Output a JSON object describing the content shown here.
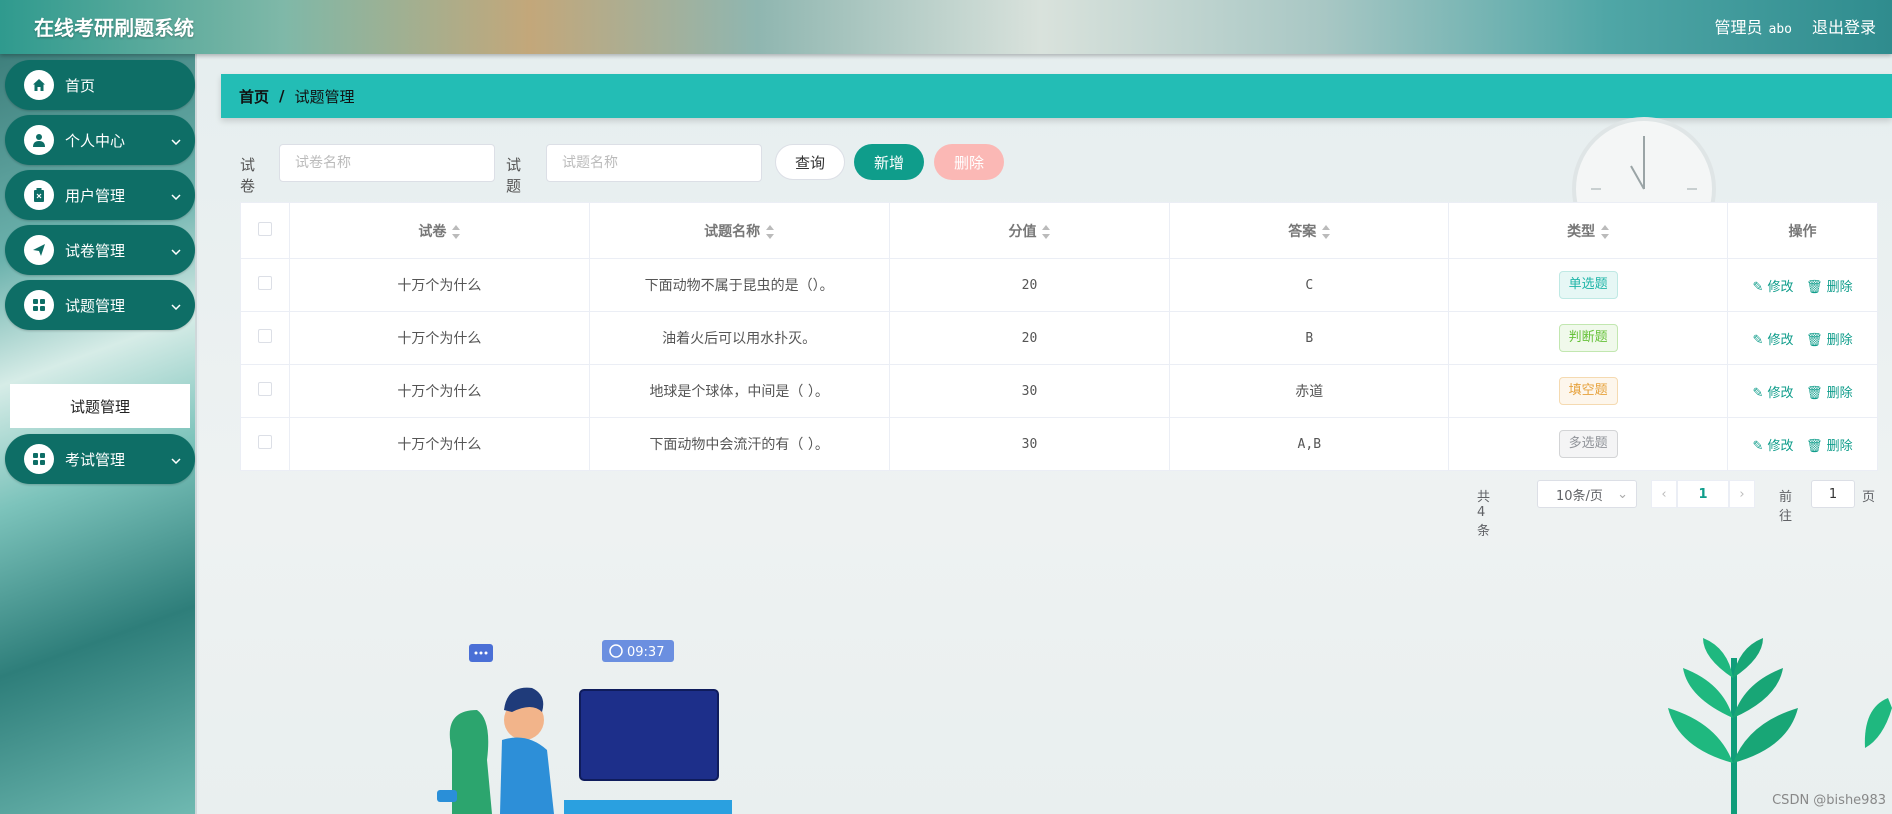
{
  "header": {
    "title": "在线考研刷题系统",
    "role": "管理员",
    "username": "abo",
    "logout": "退出登录"
  },
  "sidebar": {
    "items": [
      {
        "label": "首页",
        "icon": "home-icon"
      },
      {
        "label": "个人中心",
        "icon": "user-icon"
      },
      {
        "label": "用户管理",
        "icon": "clipboard-icon"
      },
      {
        "label": "试卷管理",
        "icon": "send-icon"
      },
      {
        "label": "试题管理",
        "icon": "grid-icon"
      },
      {
        "label": "考试管理",
        "icon": "grid-icon"
      }
    ],
    "subitem": "试题管理"
  },
  "breadcrumb": {
    "home": "首页",
    "separator": "/",
    "current": "试题管理"
  },
  "filter": {
    "paper_label": "试卷",
    "paper_placeholder": "试卷名称",
    "question_label": "试题",
    "question_placeholder": "试题名称",
    "query_button": "查询",
    "add_button": "新增",
    "delete_button": "删除"
  },
  "table": {
    "headers": [
      "试卷",
      "试题名称",
      "分值",
      "答案",
      "类型",
      "操作"
    ],
    "edit_label": "修改",
    "delete_label": "删除",
    "rows": [
      {
        "paper": "十万个为什么",
        "question": "下面动物不属于昆虫的是（）。",
        "score": "20",
        "answer": "C",
        "type": "单选题"
      },
      {
        "paper": "十万个为什么",
        "question": "油着火后可以用水扑灭。",
        "score": "20",
        "answer": "B",
        "type": "判断题"
      },
      {
        "paper": "十万个为什么",
        "question": "地球是个球体，中间是（ ）。",
        "score": "30",
        "answer": "赤道",
        "type": "填空题"
      },
      {
        "paper": "十万个为什么",
        "question": "下面动物中会流汗的有（ ）。",
        "score": "30",
        "answer": "A,B",
        "type": "多选题"
      }
    ]
  },
  "pagination": {
    "total": "共 4 条",
    "page_size": "10条/页",
    "current_page": "1",
    "goto_label": "前往",
    "goto_value": "1",
    "page_suffix": "页"
  },
  "illustration": {
    "clock_time": "09:37"
  },
  "watermark": "CSDN @bishe983",
  "colors": {
    "primary": "#0f9d8b",
    "breadcrumb_bg": "#23bdb5",
    "sidebar_item_bg": "#0e6e66",
    "delete_btn_bg": "#fbb8b5"
  }
}
